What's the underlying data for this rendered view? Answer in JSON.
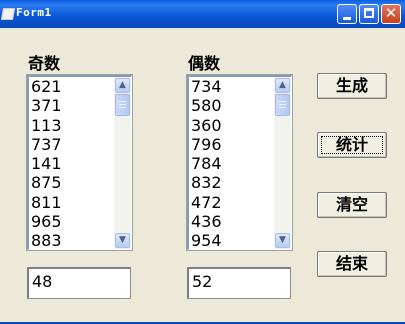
{
  "window": {
    "title": "Form1"
  },
  "labels": {
    "odd": "奇数",
    "even": "偶数"
  },
  "odd_list": [
    "621",
    "371",
    "113",
    "737",
    "141",
    "875",
    "811",
    "965",
    "883"
  ],
  "even_list": [
    "734",
    "580",
    "360",
    "796",
    "784",
    "832",
    "472",
    "436",
    "954"
  ],
  "odd_count": "48",
  "even_count": "52",
  "buttons": {
    "generate": "生成",
    "count": "统计",
    "clear": "清空",
    "end": "结束"
  },
  "icons": {
    "minimize": "minimize-icon",
    "maximize": "maximize-icon",
    "close": "close-icon",
    "scroll_up": "arrow-up-icon",
    "scroll_down": "arrow-down-icon"
  },
  "colors": {
    "titlebar": "#0A5FE0",
    "window_bg": "#ECE9D8",
    "close_button": "#C4401F"
  }
}
